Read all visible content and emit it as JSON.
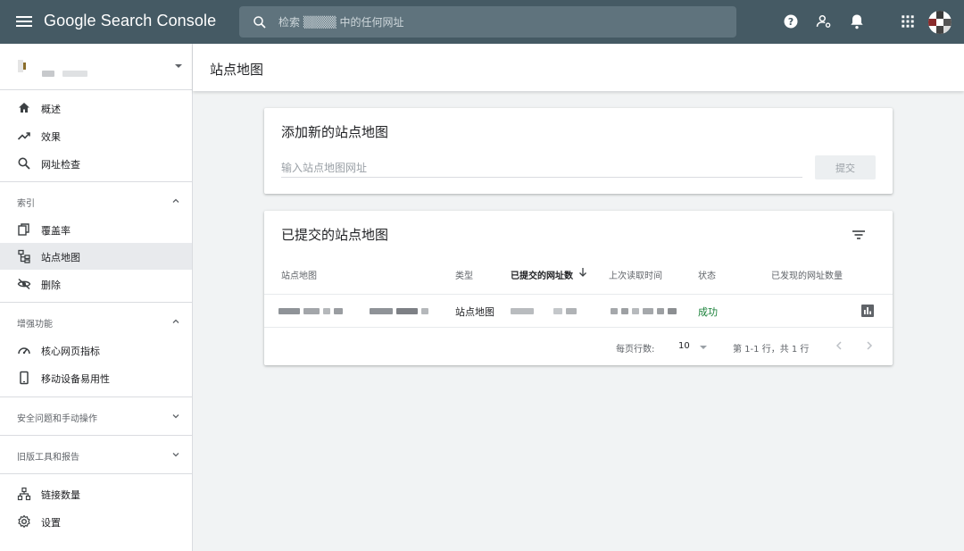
{
  "app": {
    "title": "Google Search Console",
    "search_placeholder": "检索 ▒▒▒▒ 中的任何网址"
  },
  "topbar_icons": [
    "help-icon",
    "account-settings-icon",
    "notifications-bell-icon",
    "apps-grid-icon",
    "avatar"
  ],
  "sidebar": {
    "nav_main": [
      {
        "label": "概述",
        "icon": "home-icon"
      },
      {
        "label": "效果",
        "icon": "trending-up-icon"
      },
      {
        "label": "网址检查",
        "icon": "search-icon"
      }
    ],
    "section_index": {
      "label": "索引",
      "items": [
        {
          "label": "覆盖率",
          "icon": "copy-pages-icon"
        },
        {
          "label": "站点地图",
          "icon": "sitemap-icon",
          "active": true
        },
        {
          "label": "删除",
          "icon": "visibility-off-icon"
        }
      ]
    },
    "section_enhance": {
      "label": "增强功能",
      "items": [
        {
          "label": "核心网页指标",
          "icon": "speed-gauge-icon"
        },
        {
          "label": "移动设备易用性",
          "icon": "smartphone-icon"
        }
      ]
    },
    "section_security": {
      "label": "安全问题和手动操作"
    },
    "section_legacy": {
      "label": "旧版工具和报告"
    },
    "nav_bottom": [
      {
        "label": "链接数量",
        "icon": "link-tree-icon"
      },
      {
        "label": "设置",
        "icon": "settings-gear-icon"
      }
    ]
  },
  "page": {
    "title": "站点地图"
  },
  "add_card": {
    "title": "添加新的站点地图",
    "input_placeholder": "输入站点地图网址",
    "submit_label": "提交"
  },
  "submitted_card": {
    "title": "已提交的站点地图",
    "columns": {
      "sitemap": "站点地图",
      "type": "类型",
      "submitted_urls": "已提交的网址数",
      "last_read": "上次读取时间",
      "status": "状态",
      "discovered_urls": "已发现的网址数量"
    },
    "rows": [
      {
        "type": "站点地图",
        "status": "成功"
      }
    ],
    "footer": {
      "rows_per_page_label": "每页行数:",
      "rows_per_page_value": "10",
      "range": "第 1-1 行，共 1 行"
    }
  },
  "colors": {
    "topbar": "#455a64",
    "success": "#188038",
    "active_nav": "#e8eaed"
  }
}
